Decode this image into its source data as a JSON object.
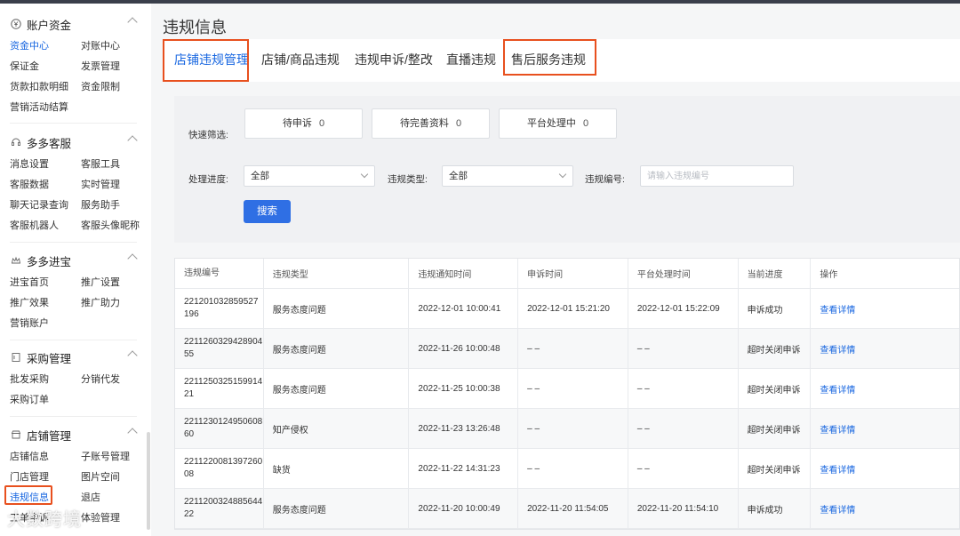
{
  "sidebar": {
    "groups": [
      {
        "title": "账户资金",
        "icon": "yen-circle-icon",
        "items": [
          "资金中心",
          "对账中心",
          "保证金",
          "发票管理",
          "货款扣款明细",
          "资金限制",
          "营销活动结算"
        ]
      },
      {
        "title": "多多客服",
        "icon": "headset-icon",
        "items": [
          "消息设置",
          "客服工具",
          "客服数据",
          "实时管理",
          "聊天记录查询",
          "服务助手",
          "客服机器人",
          "客服头像昵称"
        ]
      },
      {
        "title": "多多进宝",
        "icon": "crown-icon",
        "items": [
          "进宝首页",
          "推广设置",
          "推广效果",
          "推广助力",
          "营销账户"
        ]
      },
      {
        "title": "采购管理",
        "icon": "document-icon",
        "items": [
          "批发采购",
          "分销代发",
          "采购订单"
        ]
      },
      {
        "title": "店铺管理",
        "icon": "store-icon",
        "items": [
          "店铺信息",
          "子账号管理",
          "门店管理",
          "图片空间",
          "违规信息",
          "退店",
          "工单申诉",
          "体验管理"
        ]
      }
    ],
    "active_item": "资金中心",
    "watermark": "大数跨境"
  },
  "page": {
    "title": "违规信息"
  },
  "tabs": [
    "店铺违规管理",
    "店铺/商品违规",
    "违规申诉/整改",
    "直播违规",
    "售后服务违规"
  ],
  "filter": {
    "quick_label": "快速筛选:",
    "quick_buttons": [
      {
        "label": "待申诉",
        "count": "0"
      },
      {
        "label": "待完善资料",
        "count": "0"
      },
      {
        "label": "平台处理中",
        "count": "0"
      }
    ],
    "progress_label": "处理进度:",
    "progress_value": "全部",
    "type_label": "违规类型:",
    "type_value": "全部",
    "id_label": "违规编号:",
    "id_placeholder": "请输入违规编号",
    "search_label": "搜索"
  },
  "table": {
    "headers": [
      "违规编号",
      "违规类型",
      "违规通知时间",
      "申诉时间",
      "平台处理时间",
      "当前进度",
      "操作"
    ],
    "rows": [
      [
        "221201032859527196",
        "服务态度问题",
        "2022-12-01 10:00:41",
        "2022-12-01 15:21:20",
        "2022-12-01 15:22:09",
        "申诉成功",
        "查看详情"
      ],
      [
        "221126032942890455",
        "服务态度问题",
        "2022-11-26 10:00:48",
        "– –",
        "– –",
        "超时关闭申诉",
        "查看详情"
      ],
      [
        "221125032515991421",
        "服务态度问题",
        "2022-11-25 10:00:38",
        "– –",
        "– –",
        "超时关闭申诉",
        "查看详情"
      ],
      [
        "221123012495060860",
        "知产侵权",
        "2022-11-23 13:26:48",
        "– –",
        "– –",
        "超时关闭申诉",
        "查看详情"
      ],
      [
        "221122008139726008",
        "缺货",
        "2022-11-22 14:31:23",
        "– –",
        "– –",
        "超时关闭申诉",
        "查看详情"
      ],
      [
        "221120032488564422",
        "服务态度问题",
        "2022-11-20 10:00:49",
        "2022-11-20 11:54:05",
        "2022-11-20 11:54:10",
        "申诉成功",
        "查看详情"
      ]
    ]
  }
}
